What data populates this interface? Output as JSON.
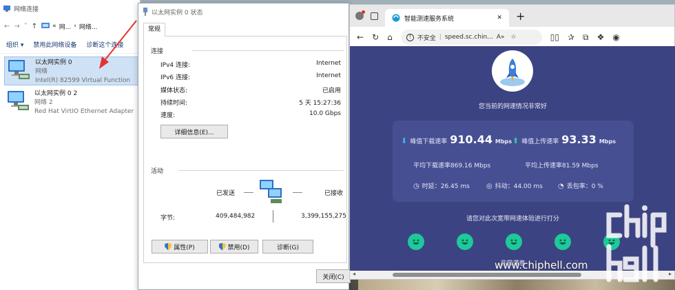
{
  "net_window": {
    "title": "网络连接",
    "breadcrumb": [
      "«",
      "网...",
      "网络..."
    ],
    "commands": [
      "组织 ▾",
      "禁用此网络设备",
      "诊断这个连接"
    ],
    "adapters": [
      {
        "name": "以太网实例 0",
        "network": "网络",
        "device": "Intel(R) 82599 Virtual Function"
      },
      {
        "name": "以太网实例 0 2",
        "network": "网络 2",
        "device": "Red Hat VirtIO Ethernet Adapter"
      }
    ]
  },
  "status_dialog": {
    "title": "以太网实例 0 状态",
    "tab": "常规",
    "connection_group": "连接",
    "rows": [
      {
        "label": "IPv4 连接:",
        "value": "Internet"
      },
      {
        "label": "IPv6 连接:",
        "value": "Internet"
      },
      {
        "label": "媒体状态:",
        "value": "已启用"
      },
      {
        "label": "持续时间:",
        "value": "5 天 15:27:36"
      },
      {
        "label": "速度:",
        "value": "10.0 Gbps"
      }
    ],
    "details_button": "详细信息(E)...",
    "activity_group": "活动",
    "sent_label": "已发送",
    "received_label": "已接收",
    "bytes_label": "字节:",
    "bytes_sent": "409,484,982",
    "bytes_received": "3,399,155,275",
    "buttons": [
      "属性(P)",
      "禁用(D)",
      "诊断(G)"
    ],
    "close_button": "关闭(C)"
  },
  "browser": {
    "tab_title": "智能测速服务系统",
    "security": "不安全",
    "url": "speed.sc.chin...",
    "page": {
      "headline": "您当前的网速情况非常好",
      "peak_download_label": "峰值下载速率",
      "peak_download_value": "910.44",
      "peak_upload_label": "峰值上传速率",
      "peak_upload_value": "93.33",
      "unit": "Mbps",
      "avg_download": "平均下载速率869.16 Mbps",
      "avg_upload": "平均上传速率81.59 Mbps",
      "latency": "时延：26.45 ms",
      "jitter": "抖动：44.00 ms",
      "loss": "丢包率：0 %",
      "rating_prompt": "请您对此次宽带网速体验进行打分",
      "rating_result": "非常满意"
    }
  },
  "watermark": {
    "url": "www.chiphell.com",
    "logo": "chip hell"
  },
  "colors": {
    "page_bg": "#3c4382",
    "card_bg": "#474f93",
    "smiley": "#1ec99a",
    "accent_blue": "#0078d4"
  }
}
